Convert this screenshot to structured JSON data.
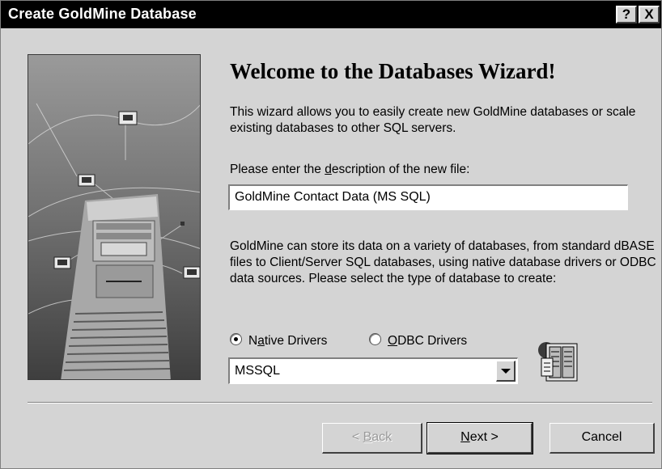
{
  "window": {
    "title": "Create GoldMine Database",
    "help_glyph": "?",
    "close_glyph": "X"
  },
  "wizard": {
    "heading": "Welcome to the Databases Wizard!",
    "intro": "This wizard allows you to easily create new GoldMine databases or scale existing databases to other SQL servers.",
    "desc_label_pre": "Please enter the ",
    "desc_label_accel": "d",
    "desc_label_post": "escription of the new file:",
    "desc_value": "GoldMine Contact Data (MS SQL)",
    "db_text": "GoldMine can store its data on a variety of databases, from standard dBASE files to Client/Server SQL databases, using native database drivers or ODBC data sources.  Please select the type of database to create:",
    "radio_native_pre": "N",
    "radio_native_accel": "a",
    "radio_native_post": "tive Drivers",
    "radio_native_checked": true,
    "radio_odbc_accel": "O",
    "radio_odbc_post": "DBC Drivers",
    "radio_odbc_checked": false,
    "db_type_value": "MSSQL",
    "icons": {
      "artwork": "network-server-illustration",
      "database": "database-server-icon"
    }
  },
  "buttons": {
    "back_pre": "< ",
    "back_accel": "B",
    "back_post": "ack",
    "back_enabled": false,
    "next_accel": "N",
    "next_post": "ext >",
    "cancel": "Cancel"
  }
}
